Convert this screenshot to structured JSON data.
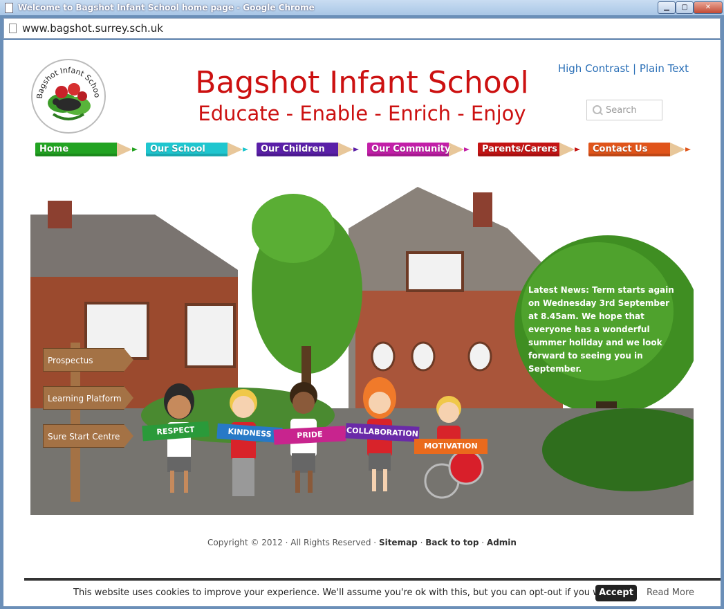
{
  "window": {
    "title": "Welcome to Bagshot Infant School home page - Google Chrome",
    "url": "www.bagshot.surrey.sch.uk",
    "buttons": {
      "minimize": "▁",
      "maximize": "▢",
      "close": "✕"
    }
  },
  "header": {
    "logo_text": "Bagshot Infant School",
    "school_name": "Bagshot Infant School",
    "tagline": "Educate - Enable - Enrich - Enjoy",
    "high_contrast": "High Contrast",
    "separator": "|",
    "plain_text": "Plain Text",
    "search_placeholder": "Search"
  },
  "nav": {
    "items": [
      {
        "label": "Home",
        "color": "#22a322"
      },
      {
        "label": "Our School",
        "color": "#1fc6cf"
      },
      {
        "label": "Our Children",
        "color": "#5a1fa8"
      },
      {
        "label": "Our Community",
        "color": "#c21fa8"
      },
      {
        "label": "Parents/Carers",
        "color": "#c41414"
      },
      {
        "label": "Contact Us",
        "color": "#e0541a"
      }
    ]
  },
  "hero": {
    "signs": [
      "Prospectus",
      "Learning Platform",
      "Sure Start Centre"
    ],
    "news": "Latest News: Term starts again on Wednesday 3rd September at 8.45am. We hope that everyone has a wonderful summer holiday and we look forward to seeing you in September.",
    "banners": [
      {
        "label": "RESPECT",
        "color": "#2a9a3a"
      },
      {
        "label": "KINDNESS",
        "color": "#2779c7"
      },
      {
        "label": "PRIDE",
        "color": "#c8248e"
      },
      {
        "label": "COLLABORATION",
        "color": "#6a2aa8"
      },
      {
        "label": "MOTIVATION",
        "color": "#ea6a1c"
      }
    ]
  },
  "footer": {
    "copyright": "Copyright © 2012 · All Rights Reserved · ",
    "sitemap": "Sitemap",
    "sep": " · ",
    "back_to_top": "Back to top",
    "admin": "Admin"
  },
  "cookie": {
    "message": "This website uses cookies to improve your experience. We'll assume you're ok with this, but you can opt-out if you wish.",
    "accept": "Accept",
    "read_more": "Read More"
  }
}
